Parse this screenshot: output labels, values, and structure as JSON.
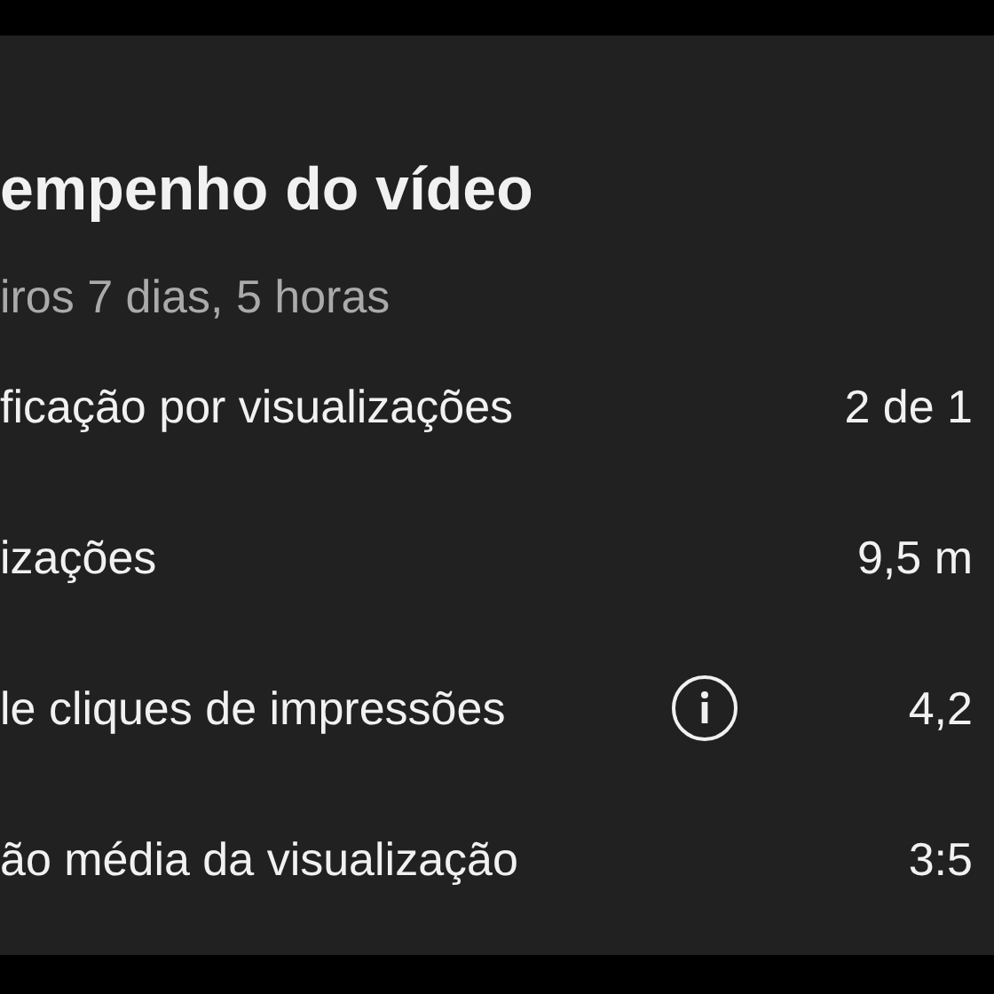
{
  "title": "empenho do vídeo",
  "subtitle": "iros 7 dias, 5 horas",
  "rows": [
    {
      "label": "ficação por visualizações",
      "value": "2 de 1",
      "info": false
    },
    {
      "label": "izações",
      "value": "9,5 m",
      "info": false
    },
    {
      "label": "le cliques de impressões",
      "value": "4,2",
      "info": true
    },
    {
      "label": "ão média da visualização",
      "value": "3:5",
      "info": false
    }
  ]
}
